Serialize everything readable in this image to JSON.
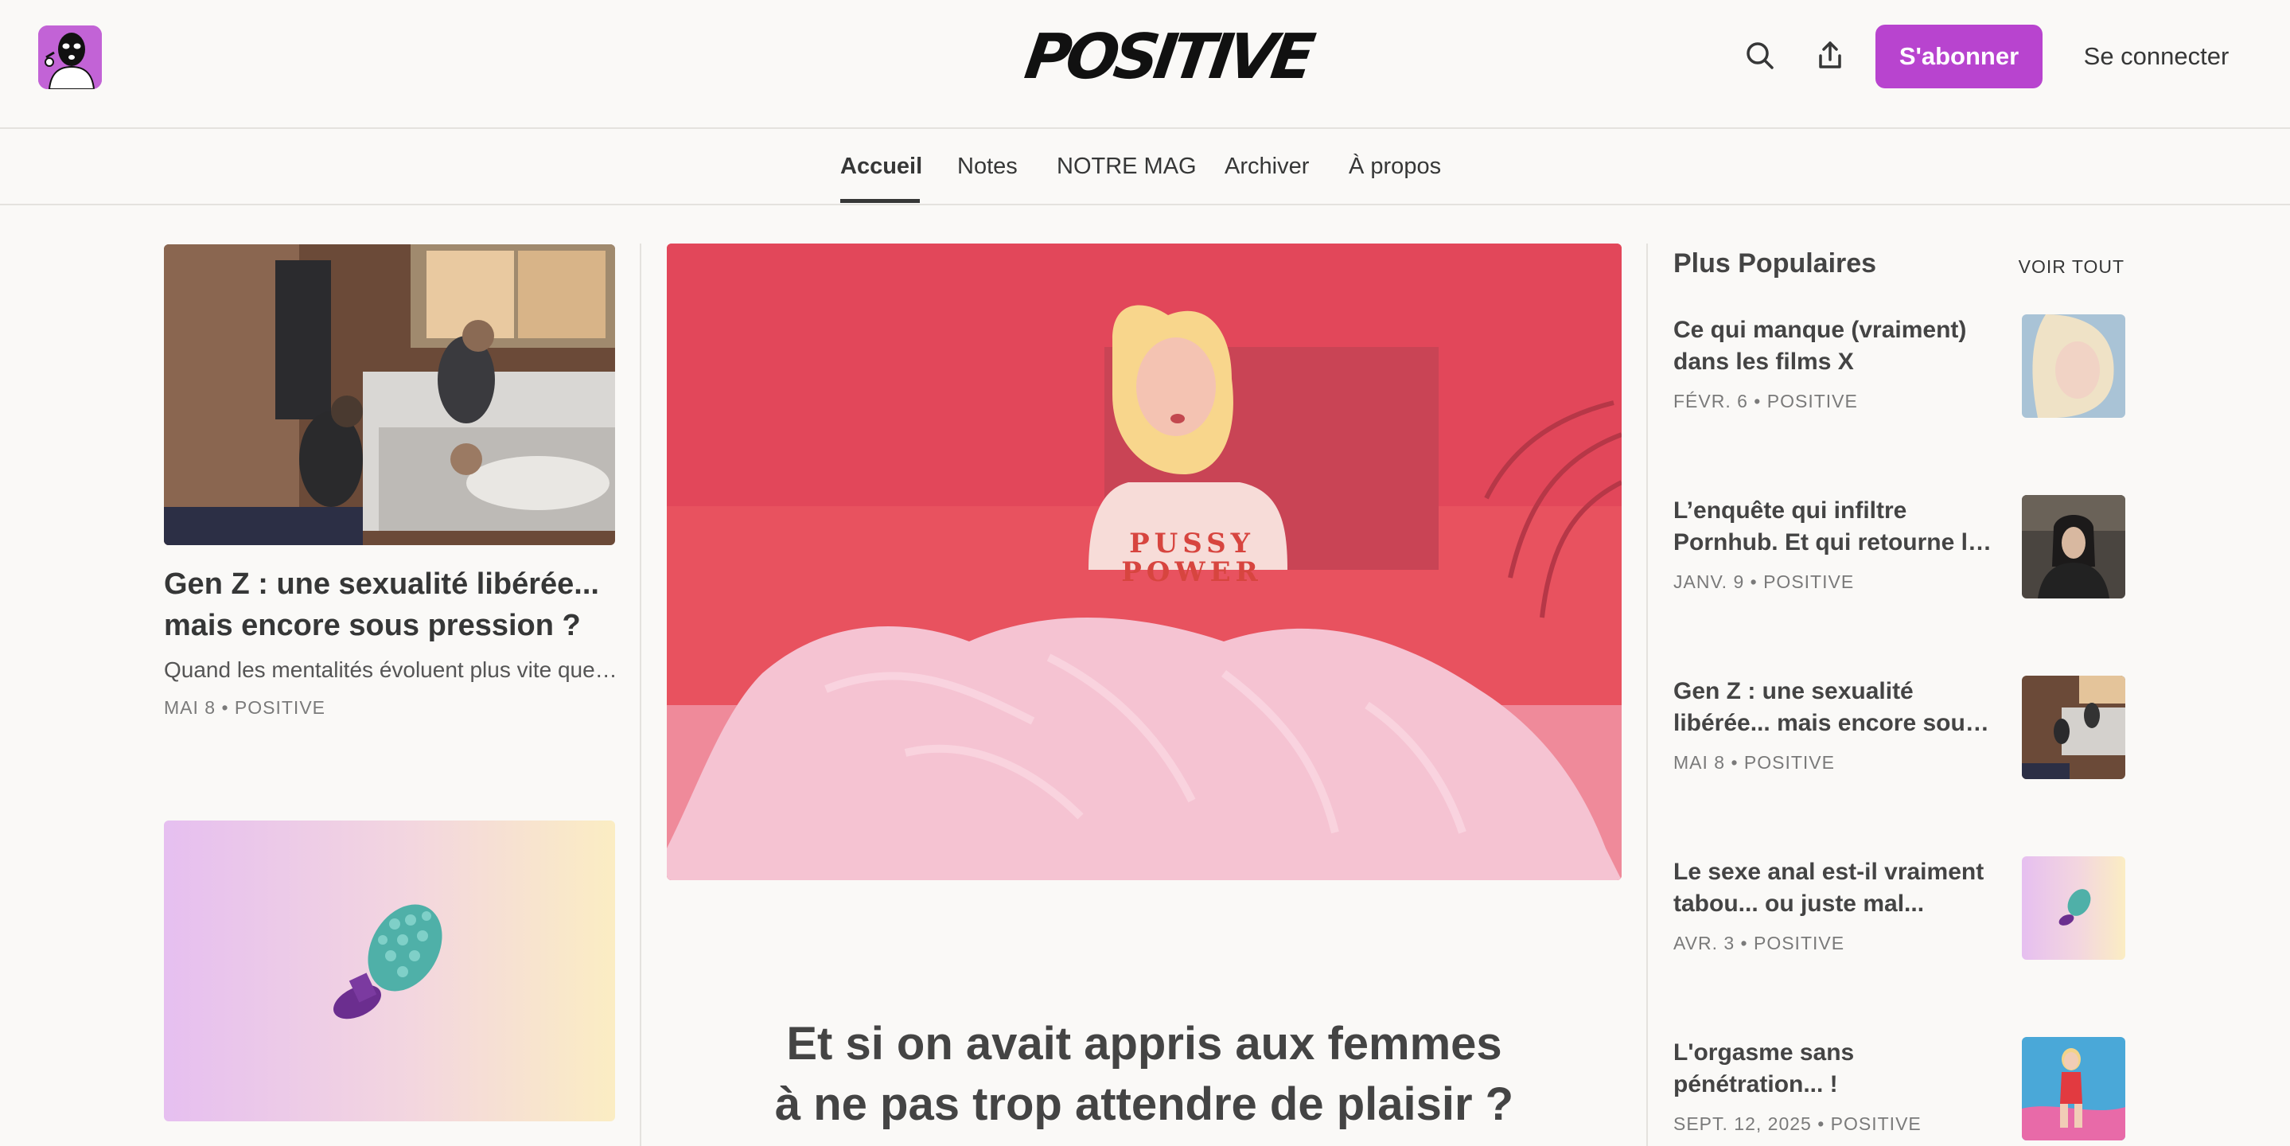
{
  "header": {
    "brand": "POSITIVE",
    "subscribe_label": "S'abonner",
    "signin_label": "Se connecter",
    "icons": [
      "search-icon",
      "share-icon"
    ]
  },
  "nav": {
    "tabs": [
      {
        "label": "Accueil",
        "active": true
      },
      {
        "label": "Notes"
      },
      {
        "label": "NOTRE MAG"
      },
      {
        "label": "Archiver"
      },
      {
        "label": "À propos"
      }
    ]
  },
  "left_posts": [
    {
      "title_line1": "Gen Z : une sexualité libérée...",
      "title_line2": "mais encore sous pression ?",
      "subtitle": "Quand les mentalités évoluent plus vite que les pratiques",
      "date": "MAI 8",
      "author": "POSITIVE"
    }
  ],
  "hero": {
    "shirt_line1": "PUSSY",
    "shirt_line2": "POWER",
    "title_line1": "Et si on avait appris aux femmes",
    "title_line2": "à ne pas trop attendre de plaisir ?"
  },
  "popular": {
    "heading": "Plus Populaires",
    "see_all": "VOIR TOUT",
    "items": [
      {
        "line1": "Ce qui manque (vraiment)",
        "line2": "dans les films X",
        "meta": "FÉVR. 6 • POSITIVE"
      },
      {
        "line1": "L’enquête qui infiltre",
        "line2": "Pornhub. Et qui retourne les tripes",
        "meta": "JANV. 9 • POSITIVE"
      },
      {
        "line1": "Gen Z : une sexualité",
        "line2": "libérée... mais encore sous pression",
        "meta": "MAI 8 • POSITIVE"
      },
      {
        "line1": "Le sexe anal est-il vraiment",
        "line2": "tabou... ou juste mal...",
        "meta": "AVR. 3 • POSITIVE"
      },
      {
        "line1": "L'orgasme sans",
        "line2": "pénétration... !",
        "meta": "SEPT. 12, 2025 • POSITIVE"
      }
    ]
  },
  "colors": {
    "accent": "#b844cf",
    "background": "#faf9f7",
    "text": "#363737",
    "hero_tint": "#e8525f"
  }
}
